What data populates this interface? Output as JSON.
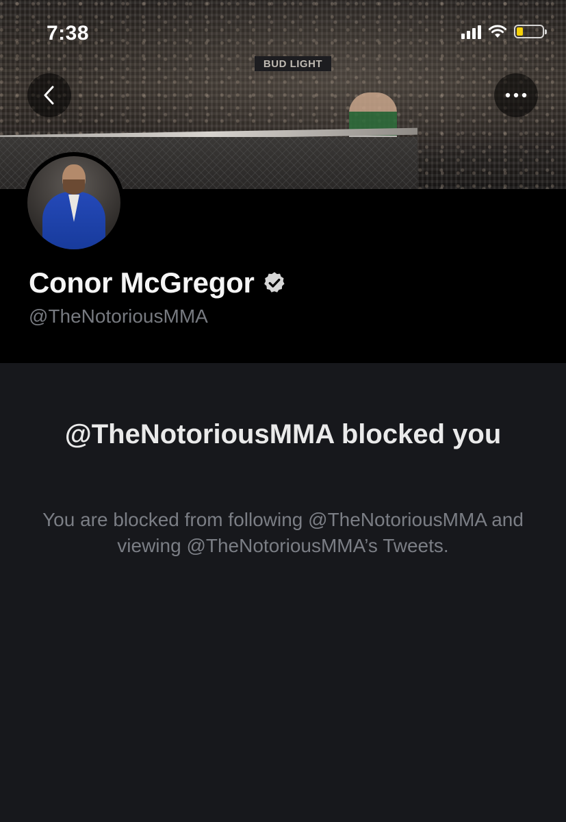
{
  "status_bar": {
    "time": "7:38",
    "signal_icon": "cellular-signal-icon",
    "wifi_icon": "wifi-icon",
    "battery_icon": "battery-icon",
    "battery_level": 0.25,
    "battery_color": "#f5d10a"
  },
  "banner": {
    "sign_text": "BUD LIGHT"
  },
  "nav": {
    "back_icon": "chevron-left-icon",
    "more_icon": "more-horizontal-icon"
  },
  "profile": {
    "name": "Conor McGregor",
    "verified_icon": "verified-badge-icon",
    "handle": "@TheNotoriousMMA"
  },
  "blocked": {
    "title": "@TheNotoriousMMA blocked you",
    "description": "You are blocked from following @TheNotoriousMMA and viewing @TheNotoriousMMA’s Tweets."
  },
  "colors": {
    "background": "#17181c",
    "header_background": "#000000",
    "secondary_text": "#7b7e85"
  }
}
